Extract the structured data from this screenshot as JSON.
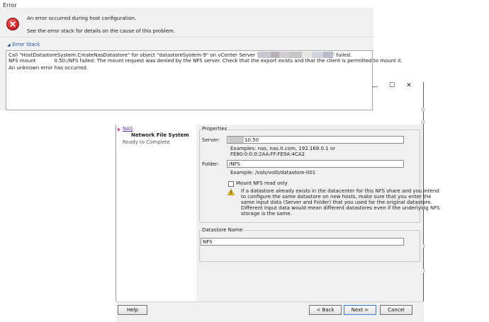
{
  "error_dialog": {
    "title": "Error",
    "message_line1": "An error occurred during host configuration.",
    "message_line2": "See the error stack for details on the cause of this problem.",
    "stack_header": "Error Stack",
    "stack_line1_a": "Call \"HostDatastoreSystem.CreateNasDatastore\" for object \"datastoreSystem-9\" on vCenter Server '",
    "stack_line1_b": "' failed.",
    "stack_line2_a": "NFS mount",
    "stack_line2_b": "0.50:/NFS failed: The mount request was denied by the NFS server. Check that the export exists and that the client is permitted to mount it.",
    "stack_line3": "An unknown error has occurred.",
    "redaction_colors": [
      "#c8c8d2",
      "#b9b0b8",
      "#d2cdd2",
      "#c4c4c4",
      "#e4e8e0",
      "#cfd4dc",
      "#b8bcc8"
    ]
  },
  "wizard": {
    "window_controls": {
      "minimize": "—",
      "maximize": "☐",
      "close": "✕"
    },
    "nav": {
      "nas": "NAS",
      "network_file_system": "Network File System",
      "ready_to_complete": "Ready to Complete"
    },
    "properties": {
      "legend": "Properties",
      "server_label": "Server:",
      "server_value": "10.50",
      "server_examples_1": "Examples: nas, nas.it.com, 192.168.0.1 or",
      "server_examples_2": "FE80:0:0:0:2AA:FF:FE9A:4CA2",
      "folder_label": "Folder:",
      "folder_value": "/NFS",
      "folder_example": "Example: /vols/vol0/datastore-001",
      "mount_readonly_label": "Mount NFS read only",
      "warning_lines": [
        "If a datastore already exists in the datacenter for this NFS share and you intend",
        "to configure the same datastore on new hosts, make sure that you enter the",
        "same input data (Server and Folder) that you used for the original datastore.",
        "Different input data would mean different datastores even if the underlying NFS",
        "storage is the same."
      ]
    },
    "datastore": {
      "legend": "Datastore Name",
      "value": "NFS"
    },
    "buttons": {
      "help": "Help",
      "back": "< Back",
      "next": "Next >",
      "cancel": "Cancel"
    }
  },
  "icons": {
    "error": "error-circle-icon",
    "warning": "warning-triangle-icon",
    "expand": "collapse-triangle-icon",
    "nav_current": "current-step-arrow-icon"
  },
  "colors": {
    "error_red": "#d62a2a",
    "link_blue": "#1a4da8",
    "nav_purple": "#5b2ea0",
    "warning_yellow": "#f4c20d",
    "dialog_bg": "#f0f0f0"
  }
}
